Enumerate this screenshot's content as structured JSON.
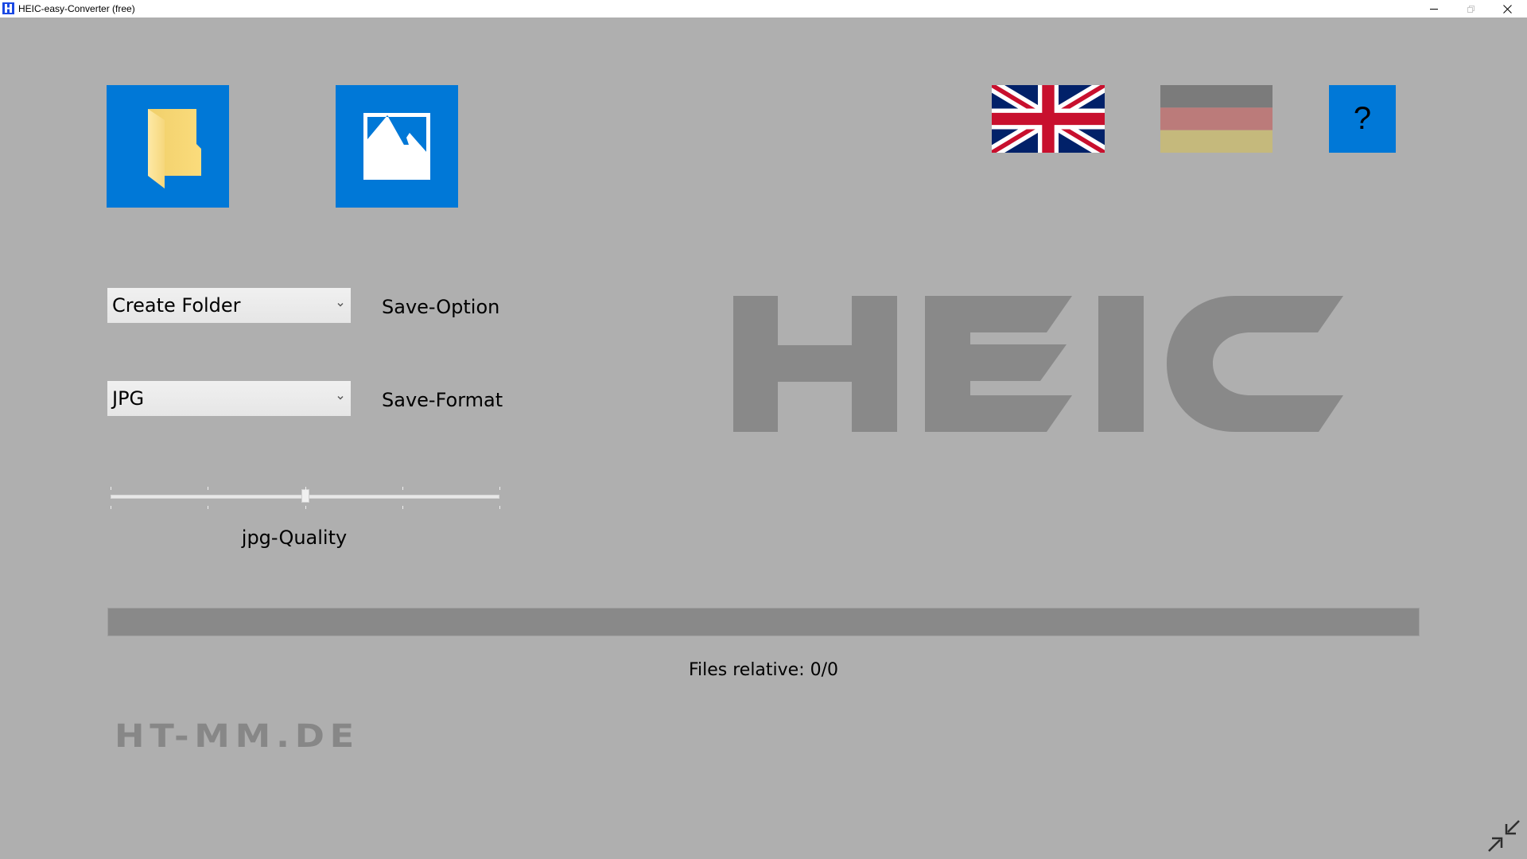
{
  "window": {
    "title": "HEIC-easy-Converter (free)",
    "app_icon_letter": "H",
    "controls": [
      "minimize",
      "restore",
      "close"
    ]
  },
  "toolbar": {
    "open_folder_icon": "folder-icon",
    "open_image_icon": "image-icon",
    "language_english": "uk-flag-icon",
    "language_german": "german-flag-icon",
    "help_label": "?"
  },
  "settings": {
    "save_option": {
      "value": "Create Folder",
      "label": "Save-Option"
    },
    "save_format": {
      "value": "JPG",
      "label": "Save-Format"
    },
    "jpg_quality": {
      "label": "jpg-Quality",
      "value_fraction": 0.5,
      "tick_count": 5
    }
  },
  "progress": {
    "value_fraction": 0,
    "status_text": "Files relative: 0/0"
  },
  "branding": {
    "product_logo": "HEIC",
    "company_logo": "HT-MM.DE"
  },
  "colors": {
    "background": "#afafaf",
    "accent_blue": "#0078d7",
    "logo_gray": "#898989",
    "flag_de": [
      "#7b7b7b",
      "#bb7b7a",
      "#c5b97c"
    ]
  },
  "footer": {
    "resize_icon": "exit-fullscreen-icon"
  }
}
